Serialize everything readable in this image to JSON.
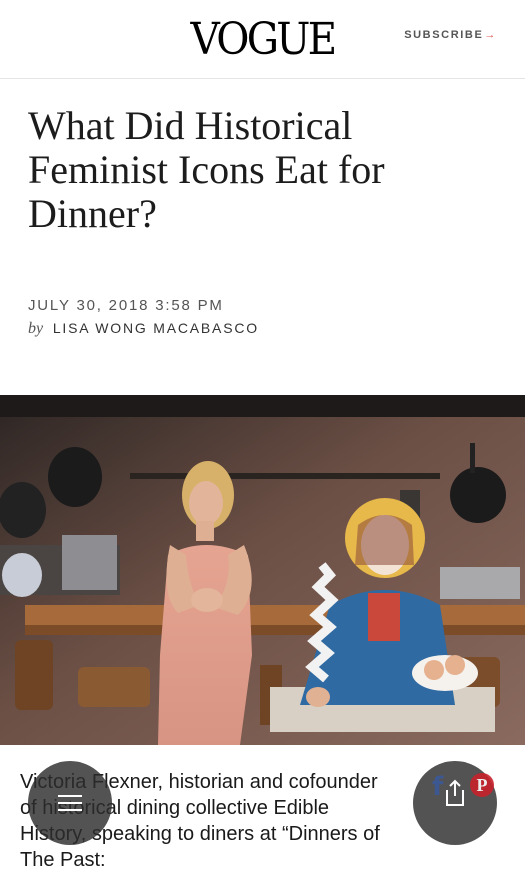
{
  "header": {
    "logo": "VOGUE",
    "subscribe_label": "SUBSCRIBE",
    "subscribe_arrow": "→"
  },
  "article": {
    "headline": "What Did Historical Feminist Icons Eat for Dinner?",
    "date": "JULY 30, 2018 3:58 PM",
    "by": "by",
    "author": "LISA WONG MACABASCO"
  },
  "photo": {
    "caption": "Victoria Flexner, historian and cofounder of historical dining collective Edible History, speaking to diners at “Dinners of The Past:"
  },
  "floating": {
    "menu_icon": "hamburger-menu-icon",
    "share_icon": "share-icon",
    "facebook_glyph": "f",
    "pinterest_glyph": "P"
  },
  "colors": {
    "accent_arrow": "#d9534f",
    "facebook": "#3b5998",
    "pinterest": "#c8232c",
    "fab_background": "#2d2d2d"
  }
}
